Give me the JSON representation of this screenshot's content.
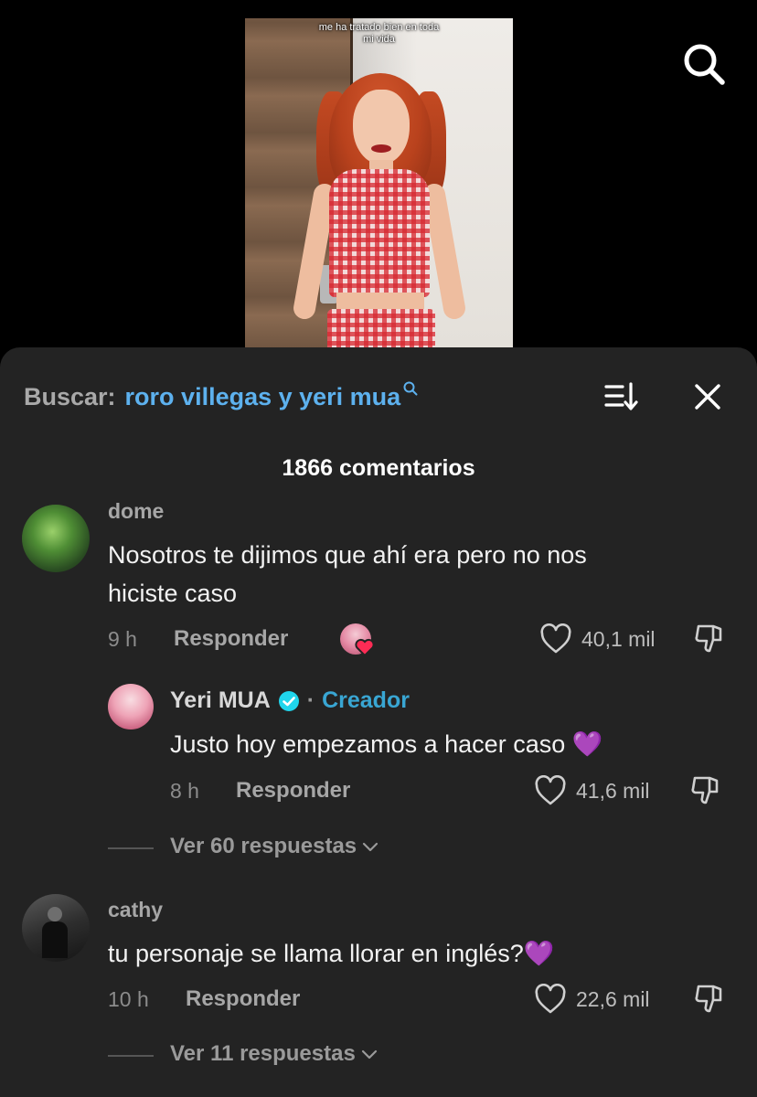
{
  "video": {
    "caption_lines": [
      "me ha tratado bien en toda",
      "mi vida"
    ]
  },
  "top_icons": {
    "search": "search-icon"
  },
  "sheet": {
    "search_prefix": "Buscar:",
    "search_query": "roro villegas y yeri mua",
    "comment_count": "1866 comentarios",
    "icons": {
      "sort": "sort-icon",
      "close": "close-icon"
    }
  },
  "comments": [
    {
      "username": "dome",
      "text_lines": [
        "Nosotros te dijimos que ahí era pero no nos",
        "hiciste caso"
      ],
      "time": "9 h",
      "reply_label": "Responder",
      "likes": "40,1 mil",
      "creator_liked": true,
      "reply": {
        "username": "Yeri MUA",
        "verified": true,
        "dot": "·",
        "badge": "Creador",
        "text": "Justo hoy empezamos a hacer caso",
        "emoji": "💜",
        "time": "8 h",
        "reply_label": "Responder",
        "likes": "41,6 mil"
      },
      "view_replies": "Ver 60 respuestas"
    },
    {
      "username": "cathy",
      "text": "tu personaje se llama llorar en inglés?",
      "emoji": "💜",
      "time": "10 h",
      "reply_label": "Responder",
      "likes": "22,6 mil",
      "view_replies": "Ver 11 respuestas"
    }
  ],
  "colors": {
    "sheet_bg": "#232323",
    "query_blue": "#5db1ee",
    "creator_blue": "#39a6d3",
    "verified_blue": "#20d5ec",
    "heart_red": "#fe2c55"
  }
}
